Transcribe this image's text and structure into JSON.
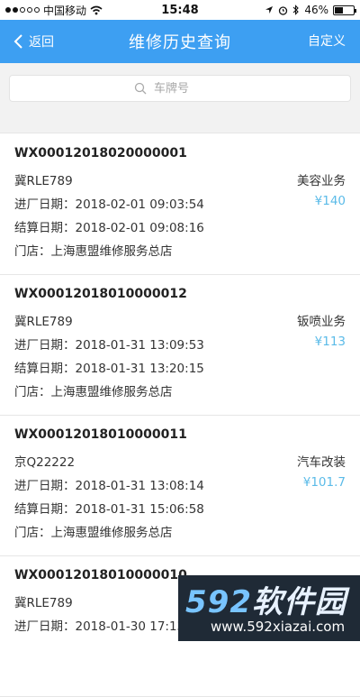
{
  "status_bar": {
    "carrier": "中国移动",
    "time": "15:48",
    "battery": "46%",
    "battery_fraction": 0.46
  },
  "nav": {
    "back_label": "返回",
    "title": "维修历史查询",
    "right_label": "自定义"
  },
  "search": {
    "placeholder": "车牌号"
  },
  "records": [
    {
      "order_no": "WX00012018020000001",
      "plate": "冀RLE789",
      "service_type": "美容业务",
      "amount": "¥140",
      "enter_date": "进厂日期：2018-02-01 09:03:54",
      "settle_date": "结算日期：2018-02-01 09:08:16",
      "store": "门店：上海惠盟维修服务总店"
    },
    {
      "order_no": "WX00012018010000012",
      "plate": "冀RLE789",
      "service_type": "钣喷业务",
      "amount": "¥113",
      "enter_date": "进厂日期：2018-01-31 13:09:53",
      "settle_date": "结算日期：2018-01-31 13:20:15",
      "store": "门店：上海惠盟维修服务总店"
    },
    {
      "order_no": "WX00012018010000011",
      "plate": "京Q22222",
      "service_type": "汽车改装",
      "amount": "¥101.7",
      "enter_date": "进厂日期：2018-01-31 13:08:14",
      "settle_date": "结算日期：2018-01-31 15:06:58",
      "store": "门店：上海惠盟维修服务总店"
    },
    {
      "order_no": "WX00012018010000010",
      "plate": "冀RLE789",
      "service_type": "",
      "amount": "",
      "enter_date": "进厂日期：2018-01-30 17:13",
      "settle_date": "",
      "store": ""
    }
  ],
  "watermark": {
    "logo": "592软件园",
    "url": "www.592xiazai.com"
  },
  "colors": {
    "nav_bg": "#3d9ff2",
    "amount": "#5bbbe8"
  }
}
